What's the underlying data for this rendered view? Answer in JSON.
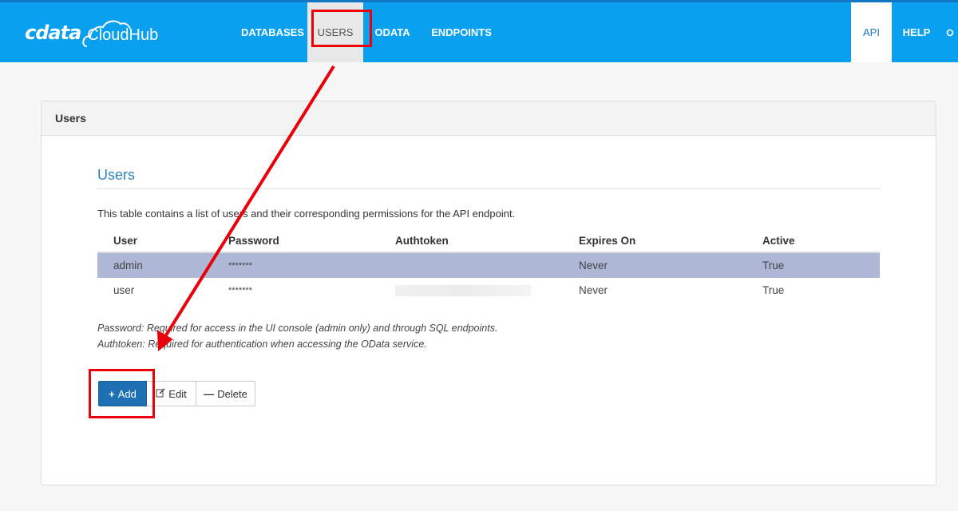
{
  "brand": {
    "logo_word": "cdata",
    "product": "CloudHub"
  },
  "nav": {
    "left": [
      {
        "label": "DATABASES",
        "active": false
      },
      {
        "label": "USERS",
        "active": true
      },
      {
        "label": "ODATA",
        "active": false
      },
      {
        "label": "ENDPOINTS",
        "active": false
      }
    ],
    "right": [
      {
        "label": "API"
      },
      {
        "label": "HELP"
      }
    ]
  },
  "panel": {
    "heading": "Users"
  },
  "section": {
    "title": "Users",
    "description": "This table contains a list of users and their corresponding permissions for the API endpoint."
  },
  "table": {
    "columns": [
      "User",
      "Password",
      "Authtoken",
      "Expires On",
      "Active"
    ],
    "rows": [
      {
        "user": "admin",
        "password": "*******",
        "authtoken": "",
        "expires": "Never",
        "active": "True",
        "selected": true
      },
      {
        "user": "user",
        "password": "*******",
        "authtoken": "",
        "expires": "Never",
        "active": "True",
        "selected": false
      }
    ]
  },
  "notes": {
    "password": "Password: Required for access in the UI console (admin only) and through SQL endpoints.",
    "authtoken": "Authtoken: Required for authentication when accessing the OData service."
  },
  "buttons": {
    "add": "Add",
    "edit": "Edit",
    "delete": "Delete"
  },
  "colors": {
    "nav_bg": "#0aa0f0",
    "accent": "#2a80bf",
    "primary_button": "#1c70b3",
    "selected_row": "#aeb8d6",
    "annotation": "#e8000b"
  }
}
